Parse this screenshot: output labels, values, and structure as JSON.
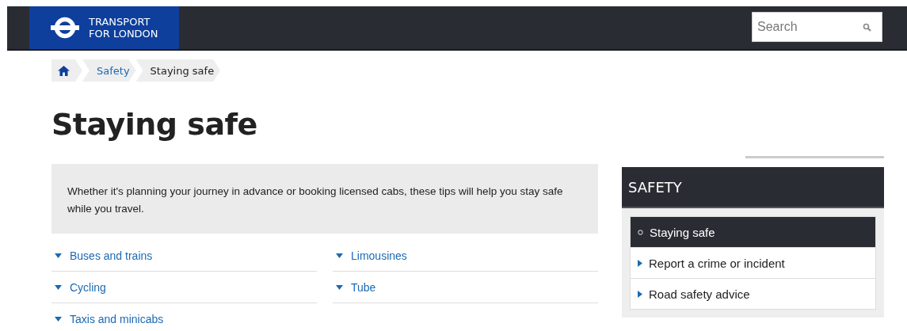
{
  "header": {
    "logo_lines": [
      "TRANSPORT",
      "FOR LONDON"
    ],
    "search": {
      "placeholder": "Search"
    }
  },
  "breadcrumb": [
    "Safety",
    "Staying safe"
  ],
  "title": "Staying safe",
  "intro": "Whether it's planning your journey in advance or booking licensed cabs, these tips will help you stay safe while you travel.",
  "links": [
    {
      "label": "Buses and trains"
    },
    {
      "label": "Limousines"
    },
    {
      "label": "Cycling"
    },
    {
      "label": "Tube"
    },
    {
      "label": "Taxis and minicabs"
    }
  ],
  "sidebar": {
    "title": "SAFETY",
    "items": [
      {
        "label": "Staying safe",
        "selected": true
      },
      {
        "label": "Report a crime or incident",
        "selected": false
      },
      {
        "label": "Road safety advice",
        "selected": false
      }
    ]
  }
}
